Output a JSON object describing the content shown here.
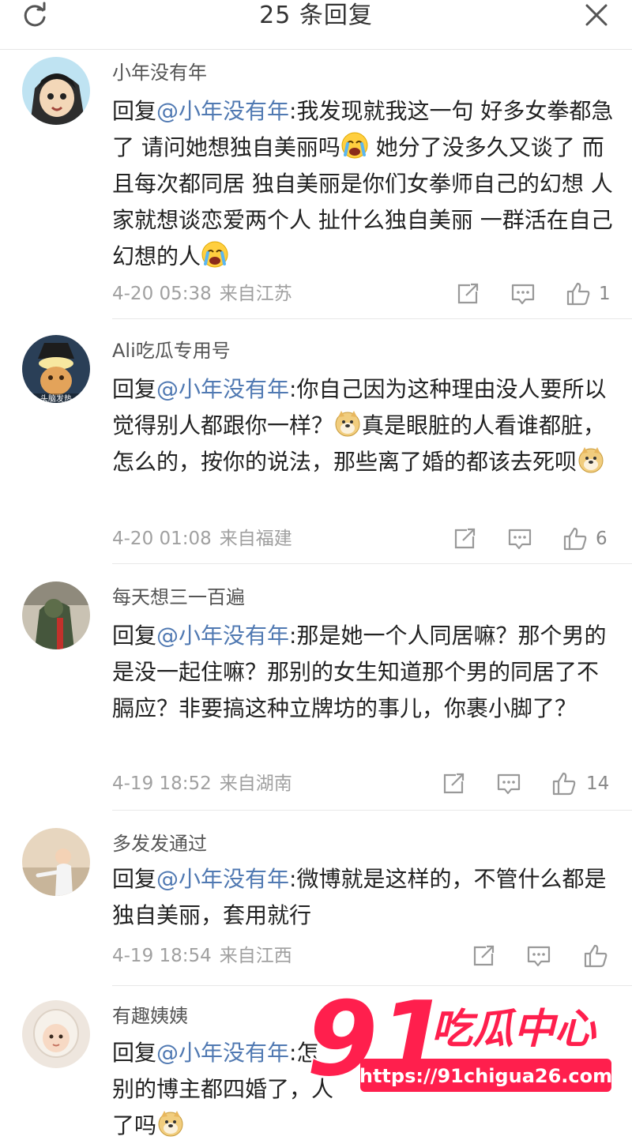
{
  "header": {
    "title": "25 条回复"
  },
  "comments": [
    {
      "user": "小年没有年",
      "prefix": "回复",
      "mention": "@小年没有年",
      "text_a": ":我发现就我这一句 好多女拳都急了 请问她想独自美丽吗",
      "text_b": " 她分了没多久又谈了 而且每次都同居 独自美丽是你们女拳师自己的幻想 人家就想谈恋爱两个人 扯什么独自美丽 一群活在自己幻想的人",
      "emoji_a": "crying-emoji",
      "emoji_b": "crying-emoji",
      "time": "4-20 05:38",
      "location": "来自江苏",
      "likes": "1"
    },
    {
      "user": "Ali吃瓜专用号",
      "prefix": "回复",
      "mention": "@小年没有年",
      "text_a": ":你自己因为这种理由没人要所以觉得别人都跟你一样？",
      "text_b": "真是眼脏的人看谁都脏，怎么的，按你的说法，那些离了婚的都该去死呗",
      "emoji_a": "doge-emoji",
      "emoji_b": "doge-emoji",
      "time": "4-20 01:08",
      "location": "来自福建",
      "likes": "6",
      "avatar_caption": "头脑发热"
    },
    {
      "user": "每天想三一百遍",
      "prefix": "回复",
      "mention": "@小年没有年",
      "text_a": ":那是她一个人同居嘛？那个男的是没一起住嘛？那别的女生知道那个男的同居了不膈应？非要搞这种立牌坊的事儿，你裹小脚了？",
      "time": "4-19 18:52",
      "location": "来自湖南",
      "likes": "14"
    },
    {
      "user": "多发发通过",
      "prefix": "回复",
      "mention": "@小年没有年",
      "text_a": ":微博就是这样的，不管什么都是独自美丽，套用就行",
      "time": "4-19 18:54",
      "location": "来自江西",
      "likes": ""
    },
    {
      "user": "有趣姨姨",
      "prefix": "回复",
      "mention": "@小年没有年",
      "text_a": ":怎",
      "text_b": "别的博主都四婚了，人",
      "text_c": "了吗",
      "emoji_c": "doge-emoji"
    }
  ],
  "watermark": {
    "number": "91",
    "name": "吃瓜中心",
    "url": "https://91chigua26.com"
  },
  "colors": {
    "mention": "#5079b2",
    "watermark": "#ff1f4d"
  }
}
